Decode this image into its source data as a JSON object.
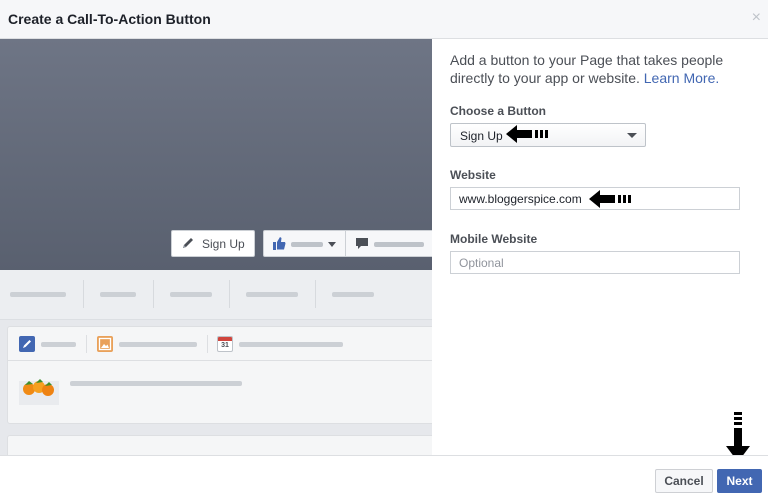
{
  "dialog": {
    "title": "Create a Call-To-Action Button",
    "close_glyph": "×"
  },
  "preview": {
    "cta_label": "Sign Up",
    "calendar_day": "31"
  },
  "panel": {
    "description": "Add a button to your Page that takes people directly to your app or website.",
    "learn_more": "Learn More.",
    "choose_label": "Choose a Button",
    "choose_value": "Sign Up",
    "website_label": "Website",
    "website_value": "www.bloggerspice.com",
    "mobile_label": "Mobile Website",
    "mobile_placeholder": "Optional"
  },
  "footer": {
    "cancel_label": "Cancel",
    "next_label": "Next"
  },
  "icons": {
    "pencil": "pencil-icon",
    "thumbs_up": "thumbs-up-icon",
    "message": "message-icon",
    "photo": "photo-icon",
    "calendar": "calendar-icon",
    "arrow": "arrow-pointer-icon"
  },
  "colors": {
    "accent": "#4267b2",
    "header_bg": "#f6f7f9",
    "cover_top": "#6e7585",
    "cover_bottom": "#59606f"
  }
}
